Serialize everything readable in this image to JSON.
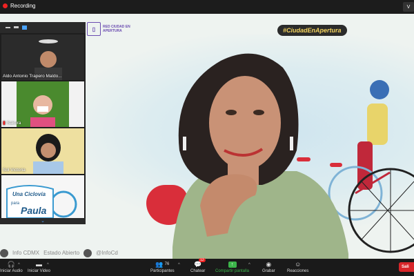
{
  "topbar": {
    "recording_label": "Recording",
    "view_label": "V"
  },
  "brand": {
    "logo_text": "RED CIUDAD EN APERTURA",
    "hashtag": "#CiudadEnApertura"
  },
  "credits": {
    "left": "Info CDMX",
    "middle": "Estado Abierto",
    "twitter": "@InfoCd"
  },
  "gallery": {
    "tiles": [
      {
        "name": "Aldo Antonio Trapero Maldo..."
      },
      {
        "name": "Sakura",
        "muted": true
      },
      {
        "name": "Sol Victoria"
      },
      {
        "name": "",
        "title_line1": "Una Ciclovía",
        "title_line2": "para",
        "title_line3": "Paula"
      }
    ]
  },
  "toolbar": {
    "audio_label": "Iniciar Audio",
    "video_label": "Iniciar Video",
    "participants_label": "Participantes",
    "participants_count": "76",
    "chat_label": "Chatear",
    "chat_badge": "12",
    "share_label": "Compartir pantalla",
    "record_label": "Grabar",
    "reactions_label": "Reacciones",
    "end_label": "Sali"
  },
  "colors": {
    "accent_green": "#3cb54a",
    "end_red": "#d8262a",
    "brand_purple": "#6a4bb0"
  }
}
